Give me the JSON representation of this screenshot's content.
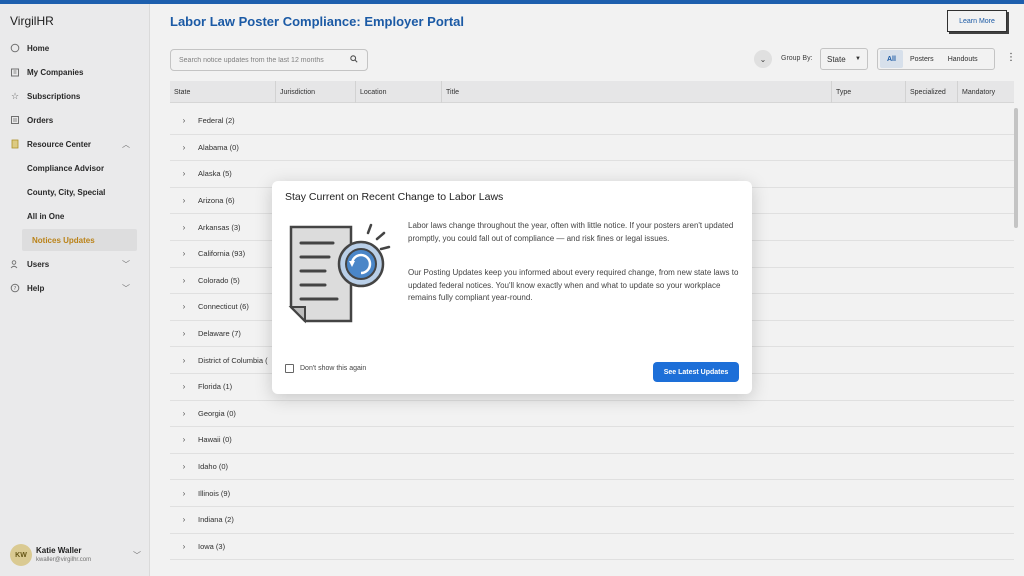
{
  "app": {
    "brand": "VirgilHR"
  },
  "sidebar": {
    "items": [
      {
        "label": "Home",
        "icon": "home-icon"
      },
      {
        "label": "My Companies",
        "icon": "building-icon"
      },
      {
        "label": "Subscriptions",
        "icon": "star-icon"
      },
      {
        "label": "Orders",
        "icon": "list-icon"
      },
      {
        "label": "Resource Center",
        "icon": "document-icon"
      }
    ],
    "resource_sub": [
      {
        "label": "Compliance Advisor"
      },
      {
        "label": "County, City, Special"
      },
      {
        "label": "All in One"
      },
      {
        "label": "Notices Updates"
      }
    ],
    "bottom_items": [
      {
        "label": "Users",
        "icon": "users-icon"
      },
      {
        "label": "Help",
        "icon": "help-icon"
      }
    ],
    "user": {
      "initials": "KW",
      "name": "Katie Waller",
      "email": "kwaller@virgilhr.com"
    }
  },
  "header": {
    "title": "Labor Law Poster Compliance: Employer Portal",
    "learn_more": "Learn More"
  },
  "toolbar": {
    "search_placeholder": "Search notice updates from the last 12 months",
    "group_by_label": "Group By:",
    "group_by_value": "State",
    "filters": [
      "All",
      "Posters",
      "Handouts"
    ],
    "active_filter": "All"
  },
  "table": {
    "columns": [
      "State",
      "Jurisdiction",
      "Location",
      "Title",
      "Type",
      "Specialized",
      "Mandatory"
    ],
    "rows": [
      "Federal (2)",
      "Alabama (0)",
      "Alaska (5)",
      "Arizona (6)",
      "Arkansas (3)",
      "California (93)",
      "Colorado (5)",
      "Connecticut (6)",
      "Delaware (7)",
      "District of Columbia (",
      "Florida (1)",
      "Georgia (0)",
      "Hawaii (0)",
      "Idaho (0)",
      "Illinois (9)",
      "Indiana (2)",
      "Iowa (3)"
    ]
  },
  "modal": {
    "title": "Stay Current on Recent Change to Labor Laws",
    "paragraph1": "Labor laws change throughout the year, often with little notice. If your posters aren't updated promptly, you could fall out of compliance — and risk fines or legal issues.",
    "paragraph2": "Our Posting Updates keep you informed about every required change, from new state laws to updated federal notices. You'll know exactly when and what to update so your workplace remains fully compliant year-round.",
    "checkbox_label": "Don't show this again",
    "cta": "See Latest Updates"
  },
  "colors": {
    "brand": "#1d5fae",
    "cta": "#1d6fd8",
    "active_sub": "#c58a1a"
  }
}
